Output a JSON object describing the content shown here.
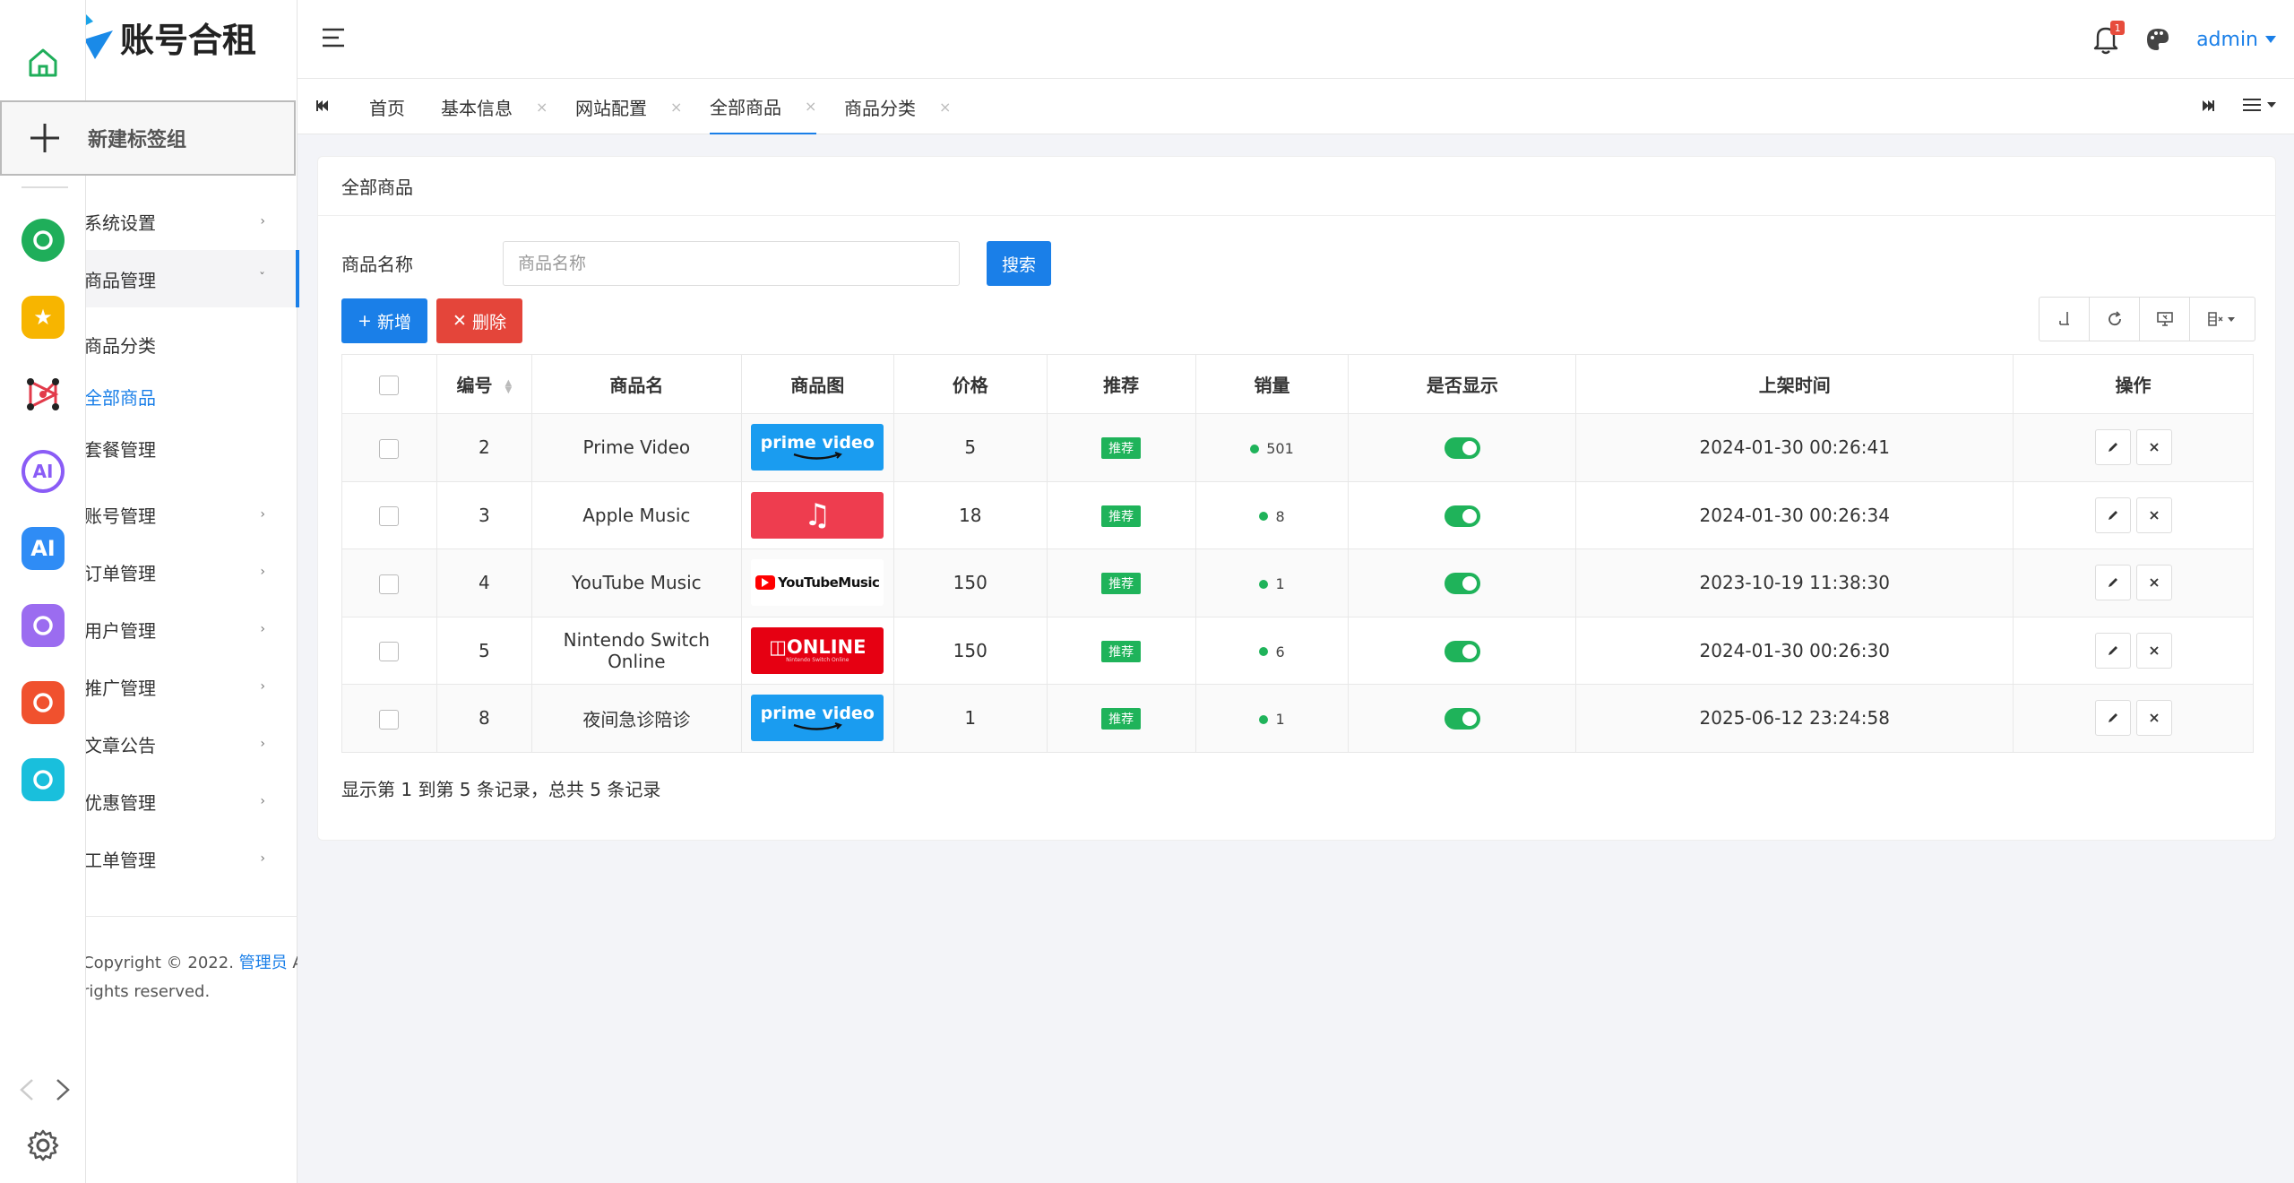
{
  "app": {
    "brand": "账号合租"
  },
  "popup": {
    "new_tab_group": "新建标签组"
  },
  "dock": {
    "apps": [
      {
        "icon": "mini-program-icon",
        "color": "#1fae5a",
        "glyph": ""
      },
      {
        "icon": "star-app-icon",
        "color": "#f7b500",
        "glyph": "★"
      },
      {
        "icon": "network-app-icon",
        "color": "#ffffff",
        "glyph": ""
      },
      {
        "icon": "ai-ring-app-icon",
        "color": "#8a5cf6",
        "glyph": "AI"
      },
      {
        "icon": "ai-app-icon",
        "color": "#2f8cf5",
        "glyph": "AI"
      },
      {
        "icon": "robot-app-icon",
        "color": "#9b6cf0",
        "glyph": ""
      },
      {
        "icon": "game-app-icon",
        "color": "#f0512e",
        "glyph": ""
      },
      {
        "icon": "puzzle-app-icon",
        "color": "#19bfdc",
        "glyph": ""
      }
    ]
  },
  "sidebar": {
    "items": [
      {
        "label": "系统设置",
        "chevron": "›"
      },
      {
        "label": "商品管理",
        "chevron": "ˇ"
      },
      {
        "label": "账号管理",
        "chevron": "›"
      },
      {
        "label": "订单管理",
        "chevron": "›"
      },
      {
        "label": "用户管理",
        "chevron": "›"
      },
      {
        "label": "推广管理",
        "chevron": "›"
      },
      {
        "label": "文章公告",
        "chevron": "›"
      },
      {
        "label": "优惠管理",
        "chevron": "›"
      },
      {
        "label": "工单管理",
        "chevron": "›"
      }
    ],
    "sub_items": [
      {
        "label": "商品分类"
      },
      {
        "label": "全部商品"
      },
      {
        "label": "套餐管理"
      }
    ],
    "copyright_pre": "Copyright © 2022. ",
    "copyright_link": "管理员",
    "copyright_post": " All",
    "copyright_line2": "rights reserved."
  },
  "header": {
    "notification_count": "1",
    "user": "admin"
  },
  "tabs": [
    {
      "label": "首页"
    },
    {
      "label": "基本信息"
    },
    {
      "label": "网站配置"
    },
    {
      "label": "全部商品"
    },
    {
      "label": "商品分类"
    }
  ],
  "tab_close": "×",
  "panel": {
    "title": "全部商品",
    "search_label": "商品名称",
    "search_placeholder": "商品名称",
    "search_button": "搜索",
    "add_button": "新增",
    "delete_button": "删除",
    "footer": "显示第 1 到第 5 条记录，总共 5 条记录"
  },
  "table": {
    "headers": [
      "编号",
      "商品名",
      "商品图",
      "价格",
      "推荐",
      "销量",
      "是否显示",
      "上架时间",
      "操作"
    ],
    "rows": [
      {
        "id": "2",
        "name": "Prime Video",
        "image": "prime",
        "price": "5",
        "tag": "推荐",
        "sales": "501",
        "time": "2024-01-30 00:26:41"
      },
      {
        "id": "3",
        "name": "Apple Music",
        "image": "apple",
        "price": "18",
        "tag": "推荐",
        "sales": "8",
        "time": "2024-01-30 00:26:34"
      },
      {
        "id": "4",
        "name": "YouTube Music",
        "image": "yt",
        "price": "150",
        "tag": "推荐",
        "sales": "1",
        "time": "2023-10-19 11:38:30"
      },
      {
        "id": "5",
        "name": "Nintendo Switch Online",
        "image": "nin",
        "price": "150",
        "tag": "推荐",
        "sales": "6",
        "time": "2024-01-30 00:26:30"
      },
      {
        "id": "8",
        "name": "夜间急诊陪诊",
        "image": "prime",
        "price": "1",
        "tag": "推荐",
        "sales": "1",
        "time": "2025-06-12 23:24:58"
      }
    ]
  },
  "images": {
    "prime_text": "prime video",
    "apple_glyph": "♫",
    "yt_text": "YouTubeMusic",
    "nin_text": "ONLINE",
    "nin_small": "Nintendo Switch Online"
  },
  "colors": {
    "accent": "#1a7fe8",
    "danger": "#e4453a",
    "success": "#1fb35a"
  }
}
